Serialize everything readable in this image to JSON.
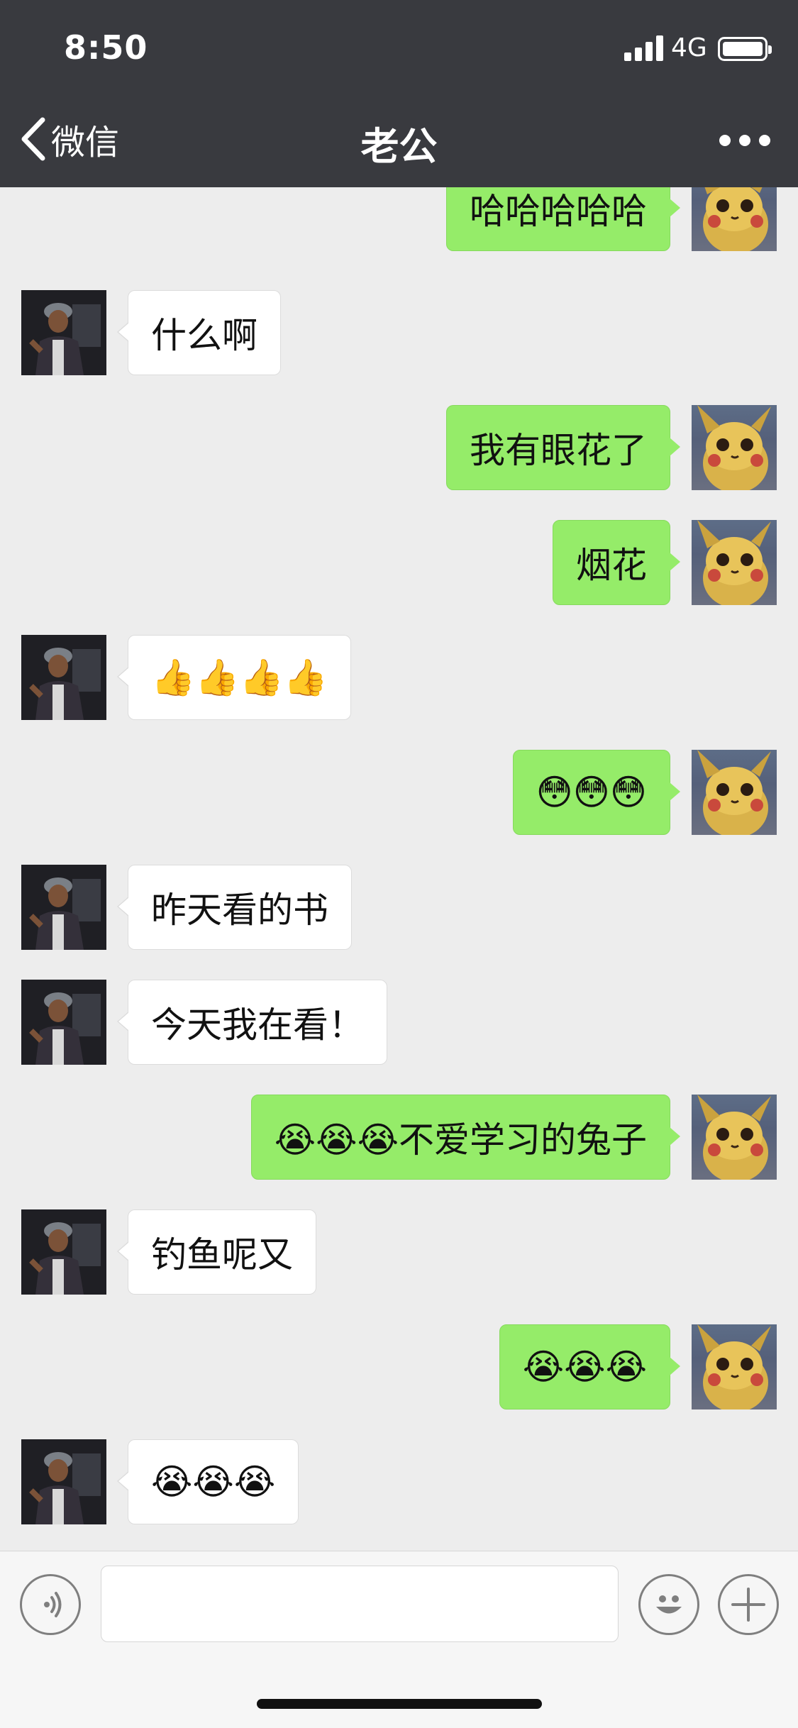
{
  "status_bar": {
    "time": "8:50",
    "network": "4G"
  },
  "nav": {
    "back_label": "微信",
    "title": "老公"
  },
  "messages": [
    {
      "side": "right",
      "text": "哈哈哈哈哈"
    },
    {
      "side": "left",
      "text": "什么啊"
    },
    {
      "side": "right",
      "text": "我有眼花了"
    },
    {
      "side": "right",
      "text": "烟花"
    },
    {
      "side": "left",
      "text": "👍👍👍👍"
    },
    {
      "side": "right",
      "text": "😳😳😳"
    },
    {
      "side": "left",
      "text": "昨天看的书"
    },
    {
      "side": "left",
      "text": "今天我在看！"
    },
    {
      "side": "right",
      "text": "😭😭😭不爱学习的兔子"
    },
    {
      "side": "left",
      "text": "钓鱼呢又"
    },
    {
      "side": "right",
      "text": "😭😭😭"
    },
    {
      "side": "left",
      "text": "😭😭😭"
    }
  ],
  "input": {
    "value": "",
    "placeholder": ""
  },
  "colors": {
    "nav_bg": "#393a3f",
    "chat_bg": "#ededed",
    "sent_bubble": "#95ec69",
    "received_bubble": "#ffffff"
  }
}
